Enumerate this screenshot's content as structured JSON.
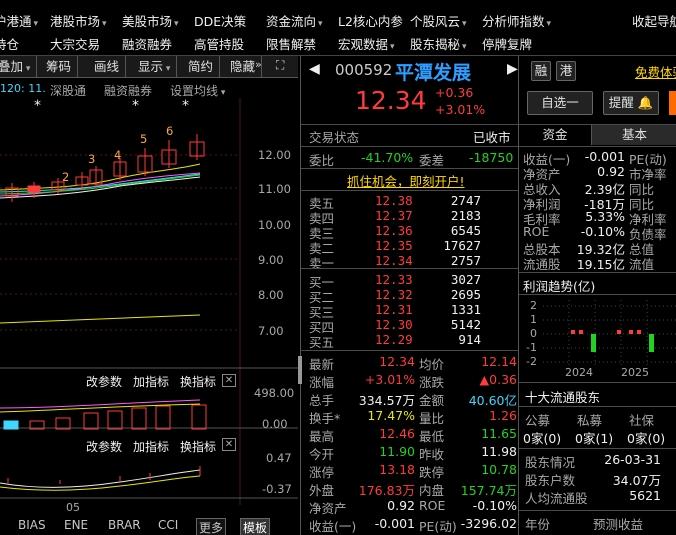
{
  "menu": {
    "row1": [
      "沪港通",
      "港股市场",
      "美股市场",
      "DDE决策",
      "资金流向",
      "L2核心内参",
      "个股风云",
      "分析师指数",
      "收起导航"
    ],
    "row1_caret": [
      true,
      true,
      true,
      false,
      true,
      false,
      true,
      true,
      false
    ],
    "row2": [
      "持仓",
      "大宗交易",
      "融资融券",
      "高管持股",
      "限售解禁",
      "宏观数据",
      "股东揭秘",
      "停牌复牌"
    ],
    "row2_caret": [
      false,
      false,
      false,
      false,
      false,
      true,
      true,
      false
    ]
  },
  "toolbar": {
    "items": [
      "叠加",
      "筹码",
      "画线",
      "显示",
      "简约",
      "隐藏"
    ],
    "carets": [
      true,
      false,
      false,
      true,
      false,
      false
    ],
    "expand_icon": "corner-expand-icon",
    "more_icon": "double-chevron-icon"
  },
  "chart": {
    "ma_label": "120: 11.",
    "tabs": [
      "深股通",
      "融资融券",
      "设置均线"
    ],
    "price_ticks": [
      "12.00",
      "11.00",
      "10.00",
      "9.00",
      "8.00",
      "7.00"
    ],
    "candle_counts": [
      "2",
      "3",
      "4",
      "5",
      "6"
    ],
    "star_marks": [
      "*",
      "*",
      "*"
    ],
    "volume_panel_tools": [
      "改参数",
      "加指标",
      "换指标"
    ],
    "volume_ticks": [
      "498.00",
      "0.00"
    ],
    "indicator_panel_tools": [
      "改参数",
      "加指标",
      "换指标"
    ],
    "indicator_ticks": [
      "0.47",
      "-0.37"
    ],
    "x_label": "05",
    "bottom_tabs": [
      "BIAS",
      "ENE",
      "BRAR",
      "CCI",
      "更多",
      "模板"
    ]
  },
  "stock": {
    "code": "000592",
    "name": "平潭发展",
    "tag1": "融",
    "tag2": "港",
    "price": "12.34",
    "change": "+0.36",
    "change_pct": "+3.01%",
    "trade_status_label": "交易状态",
    "trade_status": "已收市",
    "weibi_label": "委比",
    "weibi": "-41.70%",
    "weicha_label": "委差",
    "weicha": "-18750",
    "promo": "抓住机会，即刻开户!",
    "sells": [
      {
        "label": "卖五",
        "price": "12.38",
        "vol": "2747"
      },
      {
        "label": "卖四",
        "price": "12.37",
        "vol": "2183"
      },
      {
        "label": "卖三",
        "price": "12.36",
        "vol": "6545"
      },
      {
        "label": "卖二",
        "price": "12.35",
        "vol": "17627"
      },
      {
        "label": "卖一",
        "price": "12.34",
        "vol": "2757"
      }
    ],
    "buys": [
      {
        "label": "买一",
        "price": "12.33",
        "vol": "3027"
      },
      {
        "label": "买二",
        "price": "12.32",
        "vol": "2695"
      },
      {
        "label": "买三",
        "price": "12.31",
        "vol": "1331"
      },
      {
        "label": "买四",
        "price": "12.30",
        "vol": "5142"
      },
      {
        "label": "买五",
        "price": "12.29",
        "vol": "914"
      }
    ],
    "stats": [
      {
        "l1": "最新",
        "v1": "12.34",
        "c1": "red",
        "l2": "均价",
        "v2": "12.14",
        "c2": "red"
      },
      {
        "l1": "涨幅",
        "v1": "+3.01%",
        "c1": "red",
        "l2": "涨跌",
        "v2": "▲0.36",
        "c2": "red"
      },
      {
        "l1": "总手",
        "v1": "334.57万",
        "c1": "white",
        "l2": "金额",
        "v2": "40.60亿",
        "c2": "cyan"
      },
      {
        "l1": "换手*",
        "v1": "17.47%",
        "c1": "yellow",
        "l2": "量比",
        "v2": "1.26",
        "c2": "red"
      },
      {
        "l1": "最高",
        "v1": "12.46",
        "c1": "red",
        "l2": "最低",
        "v2": "11.65",
        "c2": "green"
      },
      {
        "l1": "今开",
        "v1": "11.90",
        "c1": "green",
        "l2": "昨收",
        "v2": "11.98",
        "c2": "white"
      },
      {
        "l1": "涨停",
        "v1": "13.18",
        "c1": "red",
        "l2": "跌停",
        "v2": "10.78",
        "c2": "green"
      },
      {
        "l1": "外盘",
        "v1": "176.83万",
        "c1": "red",
        "l2": "内盘",
        "v2": "157.74万",
        "c2": "green"
      },
      {
        "l1": "净资产",
        "v1": "0.92",
        "c1": "white",
        "l2": "ROE",
        "v2": "-0.10%",
        "c2": "white"
      },
      {
        "l1": "收益(一)",
        "v1": "-0.001",
        "c1": "white",
        "l2": "PE(动)",
        "v2": "-3296.02",
        "c2": "white"
      }
    ]
  },
  "side": {
    "free_link": "免费体验",
    "select_btn": "自选一",
    "remind_btn": "提醒",
    "tabs": [
      "资金",
      "基本"
    ],
    "fundamentals": [
      {
        "l": "收益(一)",
        "v": "-0.001",
        "l2": "PE(动)"
      },
      {
        "l": "净资产",
        "v": "0.92",
        "l2": "市净率"
      },
      {
        "l": "总收入",
        "v": "2.39亿",
        "l2": "同比"
      },
      {
        "l": "净利润",
        "v": "-181万",
        "l2": "同比"
      },
      {
        "l": "毛利率",
        "v": "5.33%",
        "l2": "净利率"
      },
      {
        "l": "ROE",
        "v": "-0.10%",
        "l2": "负债率"
      },
      {
        "l": "总股本",
        "v": "19.32亿",
        "l2": "总值"
      },
      {
        "l": "流通股",
        "v": "19.15亿",
        "l2": "流值"
      }
    ],
    "profit_title": "利润趋势(亿)",
    "profit_ticks": [
      "2",
      "1",
      "0",
      "-1",
      "-2"
    ],
    "profit_years": [
      "2024",
      "2025"
    ],
    "holders_title": "十大流通股东",
    "holder_types": [
      "公募",
      "私募",
      "社保"
    ],
    "holder_counts": [
      "0家(0)",
      "0家(1)",
      "0家(0)"
    ],
    "holder_info": [
      {
        "l": "股东情况",
        "v": "26-03-31"
      },
      {
        "l": "股东户数",
        "v": "34.07万"
      },
      {
        "l": "人均流通股",
        "v": "5621"
      }
    ],
    "bottom_labels": [
      "年份",
      "预测收益"
    ]
  },
  "colors": {
    "up": "#ff3b3b",
    "down": "#22d222",
    "accent": "#3fd7ff",
    "yellow": "#e8e800"
  }
}
